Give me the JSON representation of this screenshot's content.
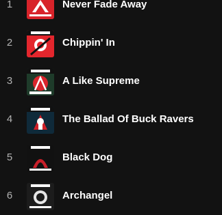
{
  "tracks": [
    {
      "number": "1",
      "title": "Never Fade Away",
      "cover_icon": "samurai-album-cover-icon",
      "cover_bg": "#d8232a"
    },
    {
      "number": "2",
      "title": "Chippin' In",
      "cover_icon": "samurai-album-cover-icon",
      "cover_bg": "#e3262d"
    },
    {
      "number": "3",
      "title": "A Like Supreme",
      "cover_icon": "samurai-album-cover-icon",
      "cover_bg": "#d9262d"
    },
    {
      "number": "4",
      "title": "The Ballad Of Buck Ravers",
      "cover_icon": "samurai-album-cover-icon",
      "cover_bg": "#cf2029"
    },
    {
      "number": "5",
      "title": "Black Dog",
      "cover_icon": "samurai-album-cover-icon",
      "cover_bg": "#111111"
    },
    {
      "number": "6",
      "title": "Archangel",
      "cover_icon": "samurai-album-cover-icon",
      "cover_bg": "#1c1c1c"
    }
  ],
  "colors": {
    "background": "#121212",
    "title": "#ffffff",
    "number": "#b3b3b3"
  }
}
